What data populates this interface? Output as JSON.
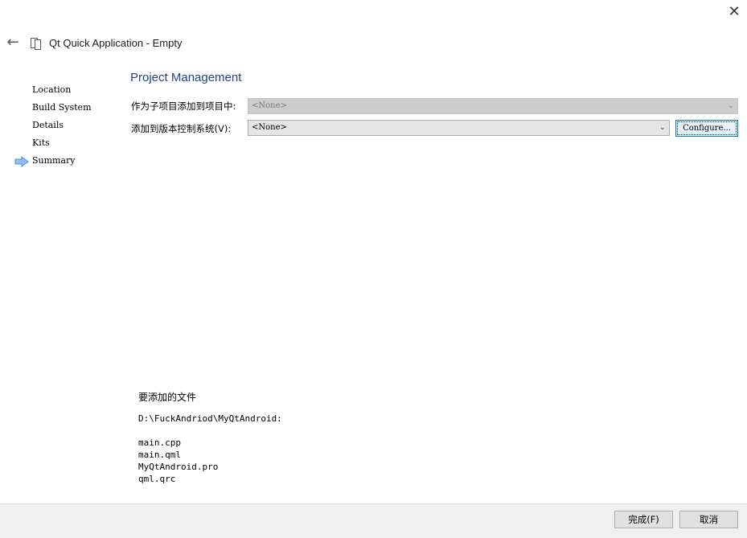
{
  "window": {
    "title": "Qt Quick Application - Empty",
    "close_glyph": "✕",
    "back_glyph": "←"
  },
  "steps": [
    {
      "label": "Location"
    },
    {
      "label": "Build System"
    },
    {
      "label": "Details"
    },
    {
      "label": "Kits"
    },
    {
      "label": "Summary"
    }
  ],
  "current_step": "Summary",
  "page": {
    "title": "Project Management",
    "add_subproject_label": "作为子项目添加到项目中:",
    "add_subproject_value": "<None>",
    "vcs_label": "添加到版本控制系统(V):",
    "vcs_value": "<None>",
    "configure_label": "Configure..."
  },
  "files": {
    "heading": "要添加的文件",
    "path": "D:\\FuckAndriod\\MyQtAndroid:",
    "list": [
      "main.cpp",
      "main.qml",
      "MyQtAndroid.pro",
      "qml.qrc"
    ]
  },
  "footer": {
    "finish_label": "完成(F)",
    "cancel_label": "取消"
  },
  "colors": {
    "title_blue": "#1f3f8f",
    "step_arrow": "#4a90d9",
    "focus_border": "#0078d7"
  }
}
